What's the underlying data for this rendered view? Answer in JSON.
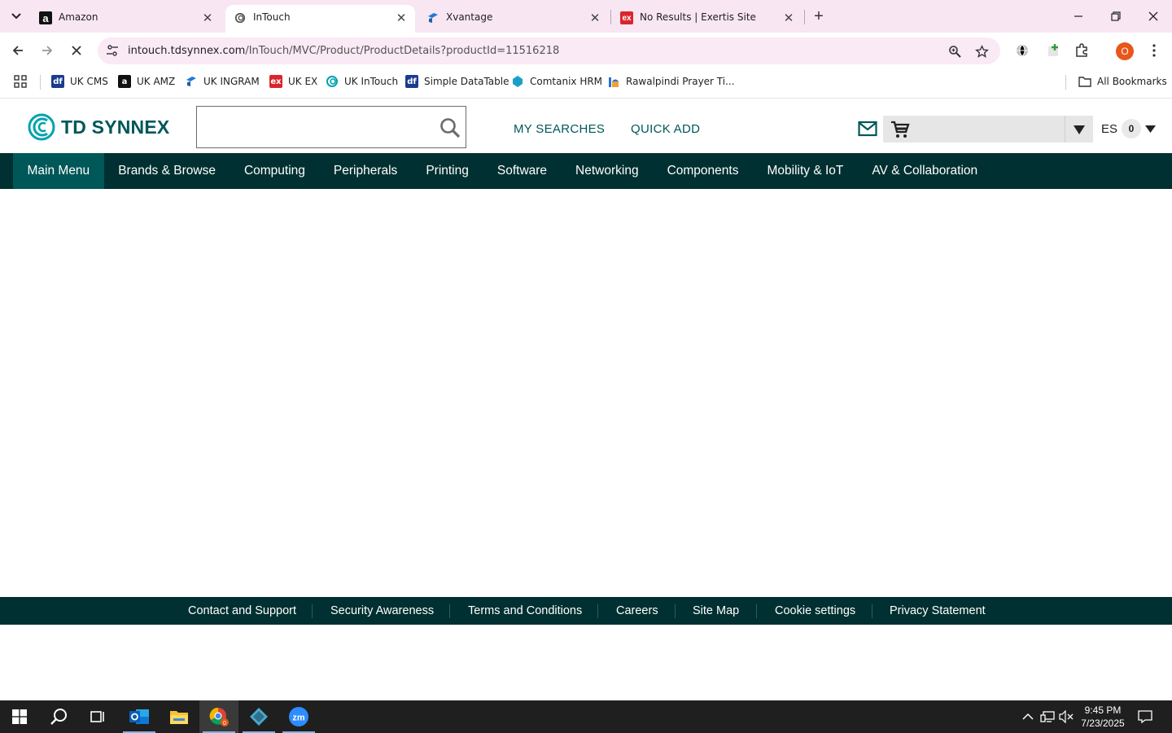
{
  "browser": {
    "tabs": [
      {
        "title": "Amazon",
        "active": false
      },
      {
        "title": "InTouch",
        "active": true
      },
      {
        "title": "Xvantage",
        "active": false
      },
      {
        "title": "No Results | Exertis Site",
        "active": false
      }
    ],
    "url_host": "intouch.tdsynnex.com",
    "url_path": "/InTouch/MVC/Product/ProductDetails?productId=11516218",
    "profile_initial": "O",
    "bookmarks": [
      {
        "label": "UK CMS",
        "color": "#1a3c8f",
        "icon_text": "df"
      },
      {
        "label": "UK AMZ",
        "color": "#111111",
        "icon_text": "a"
      },
      {
        "label": "UK INGRAM",
        "color": "#1d7bd6",
        "icon_text": ""
      },
      {
        "label": "UK EX",
        "color": "#d9262c",
        "icon_text": "ex"
      },
      {
        "label": "UK InTouch",
        "color": "#00a3ad",
        "icon_text": ""
      },
      {
        "label": "Simple DataTable",
        "color": "#1a3c8f",
        "icon_text": "df"
      },
      {
        "label": "Comtanix HRM",
        "color": "#1aa0c8",
        "icon_text": ""
      },
      {
        "label": "Rawalpindi Prayer Ti...",
        "color": "#2e6fd1",
        "icon_text": ""
      }
    ],
    "all_bookmarks_label": "All Bookmarks"
  },
  "site": {
    "logo_text": "TD SYNNEX",
    "search_placeholder": "",
    "my_searches": "MY SEARCHES",
    "quick_add": "QUICK ADD",
    "user_initials": "ES",
    "cart_count": "0",
    "brand_color": "#005758",
    "nav_color": "#003031",
    "nav": [
      "Main Menu",
      "Brands & Browse",
      "Computing",
      "Peripherals",
      "Printing",
      "Software",
      "Networking",
      "Components",
      "Mobility & IoT",
      "AV & Collaboration"
    ],
    "footer_links": [
      "Contact and Support",
      "Security Awareness",
      "Terms and Conditions",
      "Careers",
      "Site Map",
      "Cookie settings",
      "Privacy Statement"
    ]
  },
  "taskbar": {
    "time": "9:45 PM",
    "date": "7/23/2025",
    "chrome_badge": "0"
  }
}
